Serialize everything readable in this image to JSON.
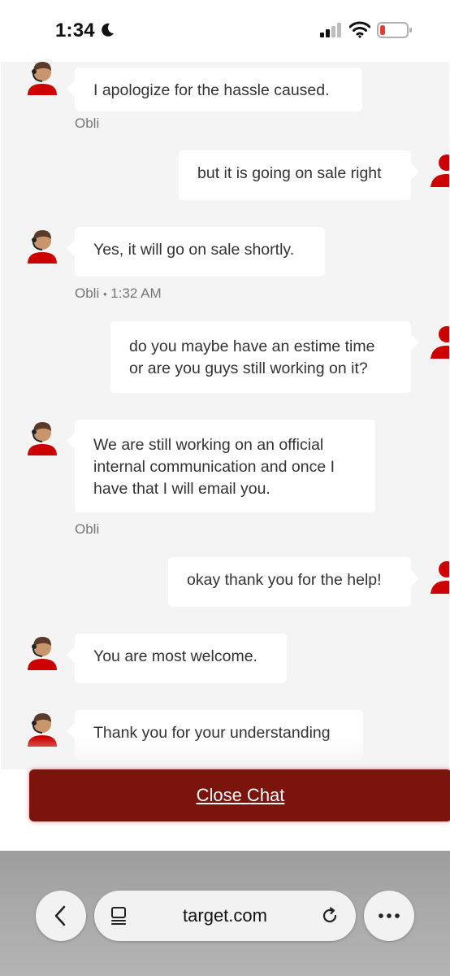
{
  "status_bar": {
    "time": "1:34",
    "icons": [
      "moon-icon",
      "signal-icon",
      "wifi-icon",
      "battery-icon"
    ],
    "battery_color": "#e53935"
  },
  "chat": {
    "messages": [
      {
        "from": "agent",
        "text": "I apologize for the hassle caused.",
        "sender": "Obli",
        "time": ""
      },
      {
        "from": "user",
        "text": "but it is going on sale right"
      },
      {
        "from": "agent",
        "text": "Yes, it will go on sale shortly.",
        "sender": "Obli",
        "time": "1:32 AM"
      },
      {
        "from": "user",
        "text": "do you maybe have an estime time or are you guys still working on it?"
      },
      {
        "from": "agent",
        "text": "We are still working on an official internal communication and once I have that I will email you.",
        "sender": "Obli",
        "time": ""
      },
      {
        "from": "user",
        "text": "okay thank you for the help!"
      },
      {
        "from": "agent",
        "text": "You are most welcome."
      },
      {
        "from": "agent",
        "text": "Thank you for your understanding"
      }
    ],
    "meta_separator": "•"
  },
  "actions": {
    "close_chat": "Close Chat"
  },
  "browser": {
    "url": "target.com"
  },
  "colors": {
    "brand_red": "#cc0000",
    "close_button": "#7b140d",
    "chat_bg": "#f4f4f4"
  }
}
